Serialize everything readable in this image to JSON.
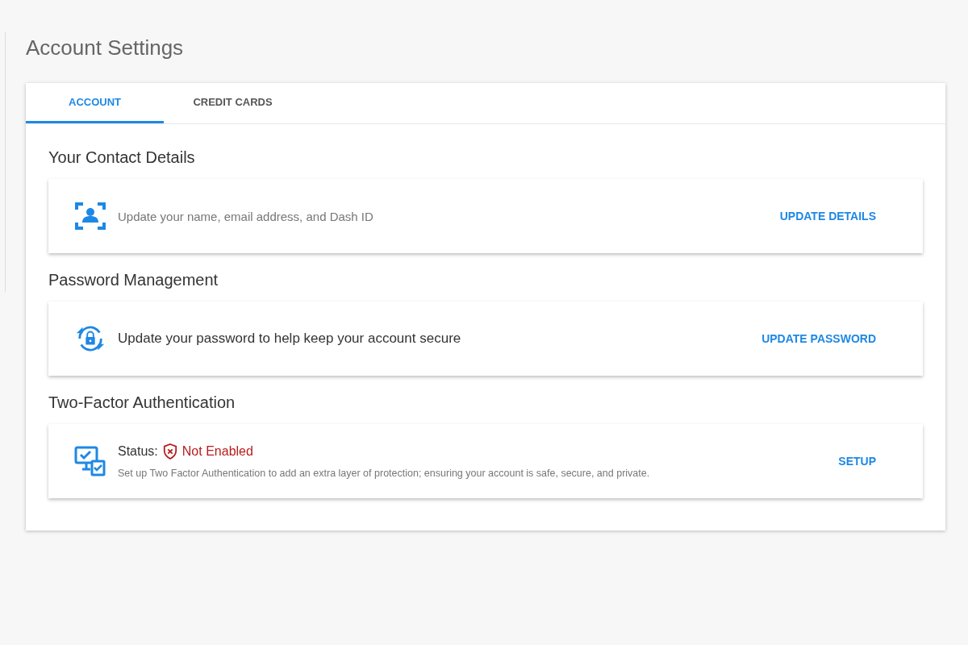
{
  "page": {
    "title": "Account Settings"
  },
  "tabs": [
    {
      "label": "ACCOUNT",
      "selected": true
    },
    {
      "label": "CREDIT CARDS",
      "selected": false
    }
  ],
  "sections": [
    {
      "kind": "plain",
      "heading": "Your Contact Details",
      "text": "Update your name, email address, and Dash ID",
      "emphasis": false,
      "action": "UPDATE DETAILS"
    },
    {
      "kind": "plain",
      "heading": "Password Management",
      "text": "Update your password to help keep your account secure",
      "emphasis": true,
      "action": "UPDATE PASSWORD"
    },
    {
      "kind": "status",
      "heading": "Two-Factor Authentication",
      "status_label": "Status:",
      "status": "Not Enabled",
      "enabled": false,
      "text": "Set up Two Factor Authentication to add an extra layer of protection; ensuring your account is safe, secure, and private.",
      "action": "SETUP"
    }
  ]
}
